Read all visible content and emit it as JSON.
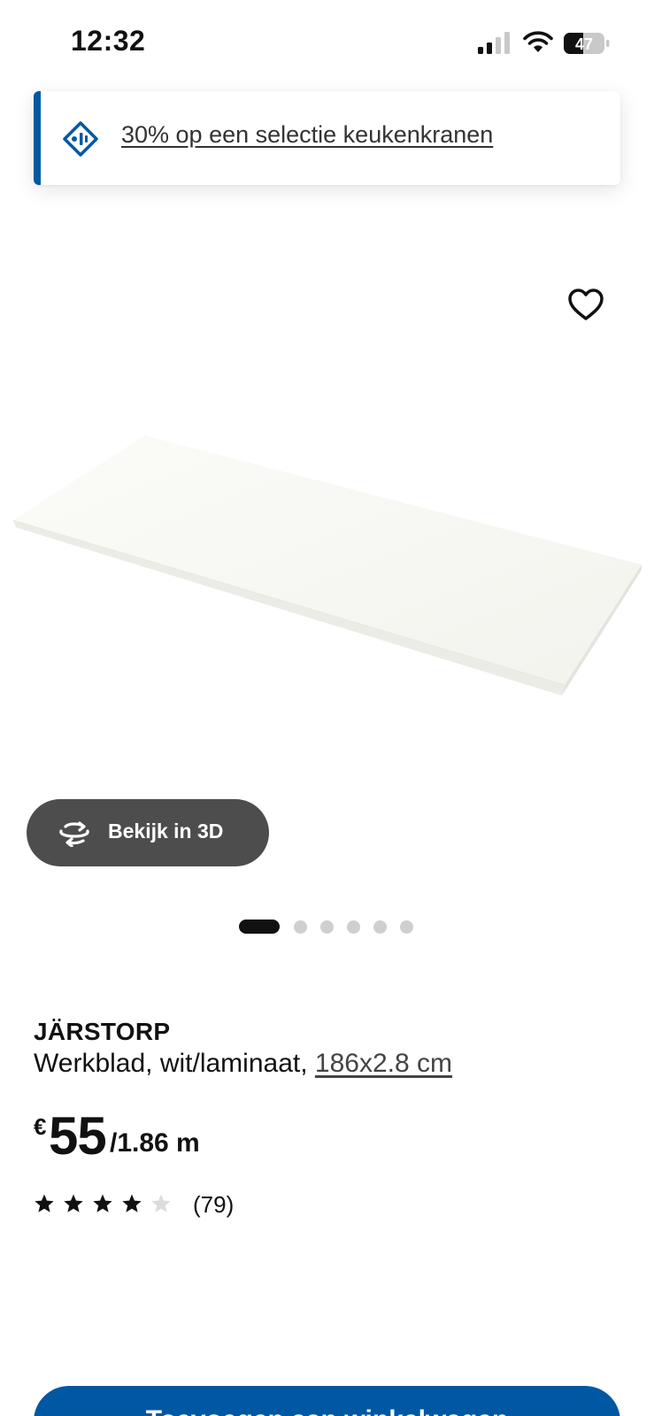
{
  "status_bar": {
    "time": "12:32",
    "battery_level": "47",
    "signal_icon": "cellular-signal-icon",
    "wifi_icon": "wifi-icon"
  },
  "promo": {
    "text": "30% op een selectie keukenkranen",
    "icon": "price-tag-icon",
    "accent_color": "#0058a3"
  },
  "media": {
    "favorite_icon": "heart-icon",
    "view_3d_label": "Bekijk in 3D",
    "view_3d_icon": "rotate-3d-icon",
    "carousel_total": 6,
    "carousel_active": 1
  },
  "product": {
    "name": "JÄRSTORP",
    "description": "Werkblad, wit/laminaat, ",
    "dimensions": "186x2.8 cm",
    "price_currency": "€",
    "price_amount": "55",
    "price_unit": "/1.86 m",
    "rating_value": 4,
    "rating_max": 5,
    "review_count": "(79)"
  },
  "cart": {
    "label": "Toevoegen aan winkelwagen",
    "color": "#0058a3"
  }
}
